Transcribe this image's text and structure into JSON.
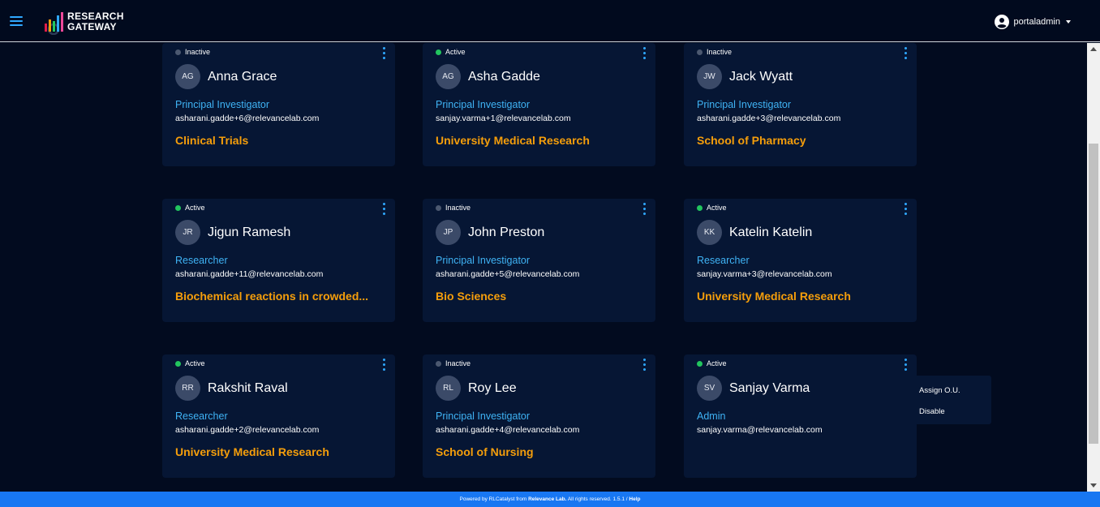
{
  "app": {
    "logo_line1": "RESEARCH",
    "logo_line2": "GATEWAY",
    "user": "portaladmin"
  },
  "colors": {
    "accent": "#2fa8ff",
    "org": "#f59e0b",
    "active": "#22c55e",
    "inactive": "#4b5870",
    "footer": "#1877f2"
  },
  "cards": [
    {
      "status": "Inactive",
      "initials": "AG",
      "name": "Anna Grace",
      "role": "Principal Investigator",
      "email": "asharani.gadde+6@relevancelab.com",
      "org": "Clinical Trials"
    },
    {
      "status": "Active",
      "initials": "AG",
      "name": "Asha Gadde",
      "role": "Principal Investigator",
      "email": "sanjay.varma+1@relevancelab.com",
      "org": "University Medical Research"
    },
    {
      "status": "Inactive",
      "initials": "JW",
      "name": "Jack Wyatt",
      "role": "Principal Investigator",
      "email": "asharani.gadde+3@relevancelab.com",
      "org": "School of Pharmacy"
    },
    {
      "status": "Active",
      "initials": "JR",
      "name": "Jigun Ramesh",
      "role": "Researcher",
      "email": "asharani.gadde+11@relevancelab.com",
      "org": "Biochemical reactions in crowded..."
    },
    {
      "status": "Inactive",
      "initials": "JP",
      "name": "John Preston",
      "role": "Principal Investigator",
      "email": "asharani.gadde+5@relevancelab.com",
      "org": "Bio Sciences"
    },
    {
      "status": "Active",
      "initials": "KK",
      "name": "Katelin Katelin",
      "role": "Researcher",
      "email": "sanjay.varma+3@relevancelab.com",
      "org": "University Medical Research"
    },
    {
      "status": "Active",
      "initials": "RR",
      "name": "Rakshit Raval",
      "role": "Researcher",
      "email": "asharani.gadde+2@relevancelab.com",
      "org": "University Medical Research"
    },
    {
      "status": "Inactive",
      "initials": "RL",
      "name": "Roy Lee",
      "role": "Principal Investigator",
      "email": "asharani.gadde+4@relevancelab.com",
      "org": "School of Nursing"
    },
    {
      "status": "Active",
      "initials": "SV",
      "name": "Sanjay Varma",
      "role": "Admin",
      "email": "sanjay.varma@relevancelab.com",
      "org": ""
    }
  ],
  "menu": {
    "assign": "Assign O.U.",
    "disable": "Disable"
  },
  "footer": {
    "prefix": "Powered by RLCatalyst from",
    "brand": "Relevance Lab.",
    "rights": "All rights reserved.",
    "version": "1.5.1",
    "sep": "/",
    "help": "Help"
  }
}
